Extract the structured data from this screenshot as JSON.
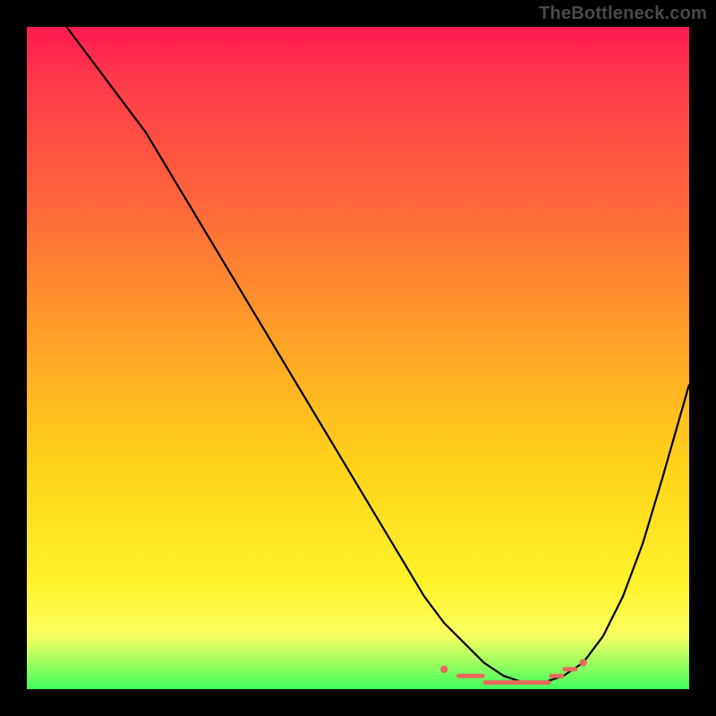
{
  "watermark": "TheBottleneck.com",
  "colors": {
    "frame_bg": "#000000",
    "watermark_text": "#4a4a4a",
    "curve": "#000000",
    "markers": "#e86a5a",
    "gradient_stops": [
      "#ff1a52",
      "#ff3a4a",
      "#ff6a3a",
      "#ffa426",
      "#ffd21a",
      "#fff22a",
      "#f8ff60",
      "#3fff5e"
    ]
  },
  "chart_data": {
    "type": "line",
    "title": "",
    "xlabel": "",
    "ylabel": "",
    "xlim": [
      0,
      100
    ],
    "ylim": [
      0,
      100
    ],
    "grid": false,
    "series": [
      {
        "name": "curve",
        "x": [
          0,
          6,
          12,
          18,
          24,
          30,
          36,
          42,
          48,
          54,
          60,
          63,
          66,
          69,
          72,
          75,
          78,
          81,
          84,
          87,
          90,
          93,
          96,
          100
        ],
        "y": [
          110,
          100,
          92,
          84,
          74,
          64,
          54,
          44,
          34,
          24,
          14,
          10,
          7,
          4,
          2,
          1,
          1,
          2,
          4,
          8,
          14,
          22,
          32,
          46
        ]
      }
    ],
    "markers": {
      "x": [
        63,
        66,
        68,
        70,
        72,
        74,
        76,
        78,
        80,
        82,
        84
      ],
      "y": [
        3,
        2,
        2,
        1,
        1,
        1,
        1,
        1,
        2,
        3,
        4
      ]
    }
  }
}
